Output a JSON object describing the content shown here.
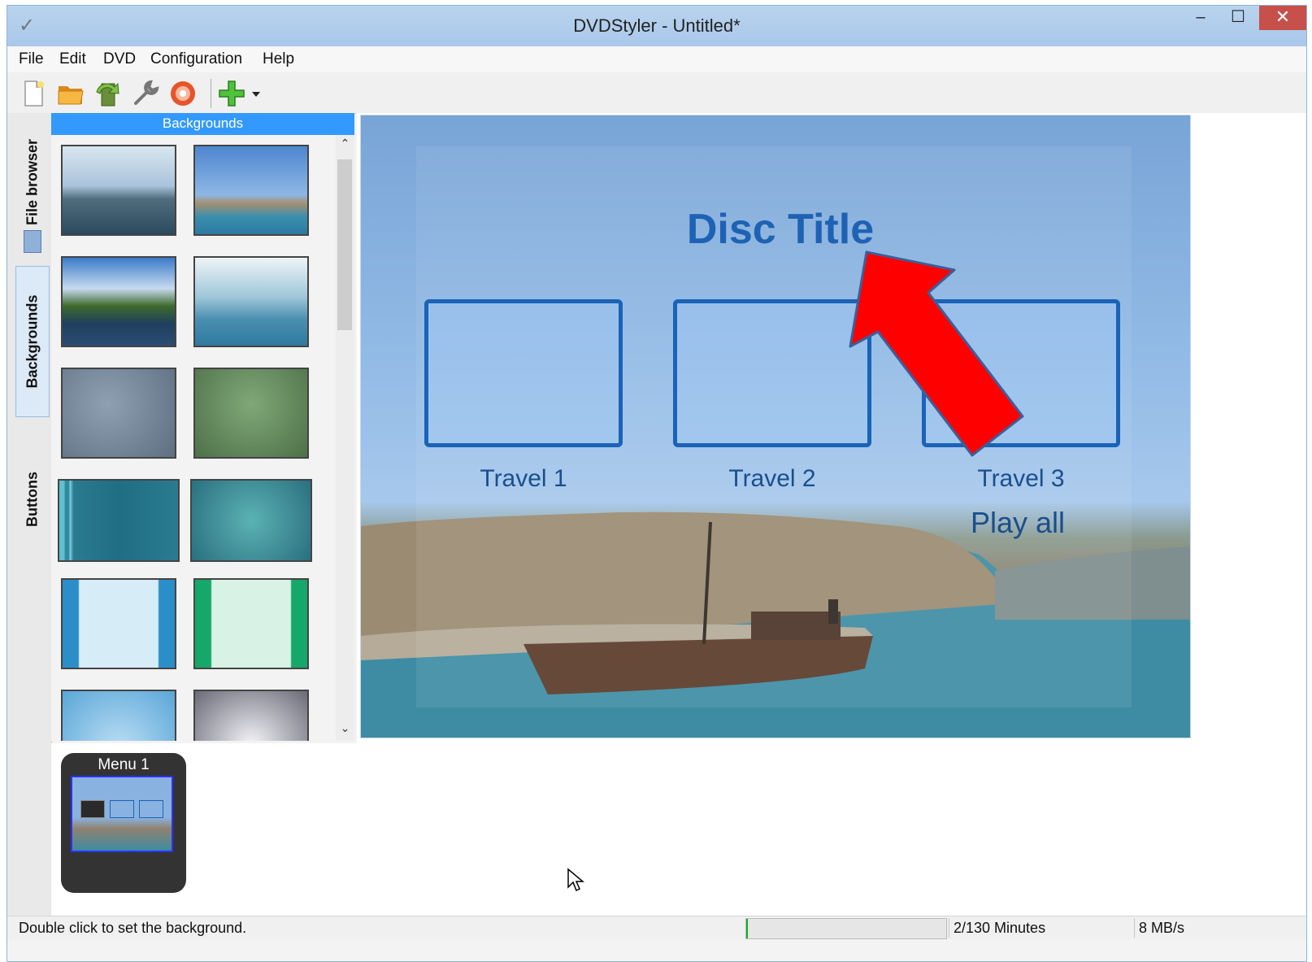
{
  "window": {
    "title": "DVDStyler - Untitled*",
    "min_glyph": "–",
    "max_glyph": "☐",
    "close_glyph": "✕"
  },
  "menubar": {
    "items": [
      "File",
      "Edit",
      "DVD",
      "Configuration",
      "Help"
    ]
  },
  "toolbar": {
    "icons": [
      "new-document-icon",
      "open-folder-icon",
      "save-arrow-icon",
      "settings-wrench-icon",
      "burn-disc-icon",
      "add-plus-icon",
      "dropdown-arrow-icon"
    ]
  },
  "side_tabs": {
    "items": [
      "File browser",
      "Backgrounds",
      "Buttons"
    ],
    "active": "Backgrounds"
  },
  "panel": {
    "title": "Backgrounds"
  },
  "canvas": {
    "disc_title": "Disc Title",
    "buttons": [
      "Travel 1",
      "Travel 2",
      "Travel 3"
    ],
    "play_all": "Play all"
  },
  "titleset": {
    "menu_label": "Menu 1"
  },
  "status": {
    "text": "Double click to set the background.",
    "progress": 0.01,
    "minutes": "2/130 Minutes",
    "rate": "8 MB/s"
  },
  "colors": {
    "accent": "#3399ff",
    "title_text": "#1e62b4",
    "frame": "#1a63b8",
    "arrow": "#ff0000",
    "arrow_outline": "#3b5f9a"
  }
}
